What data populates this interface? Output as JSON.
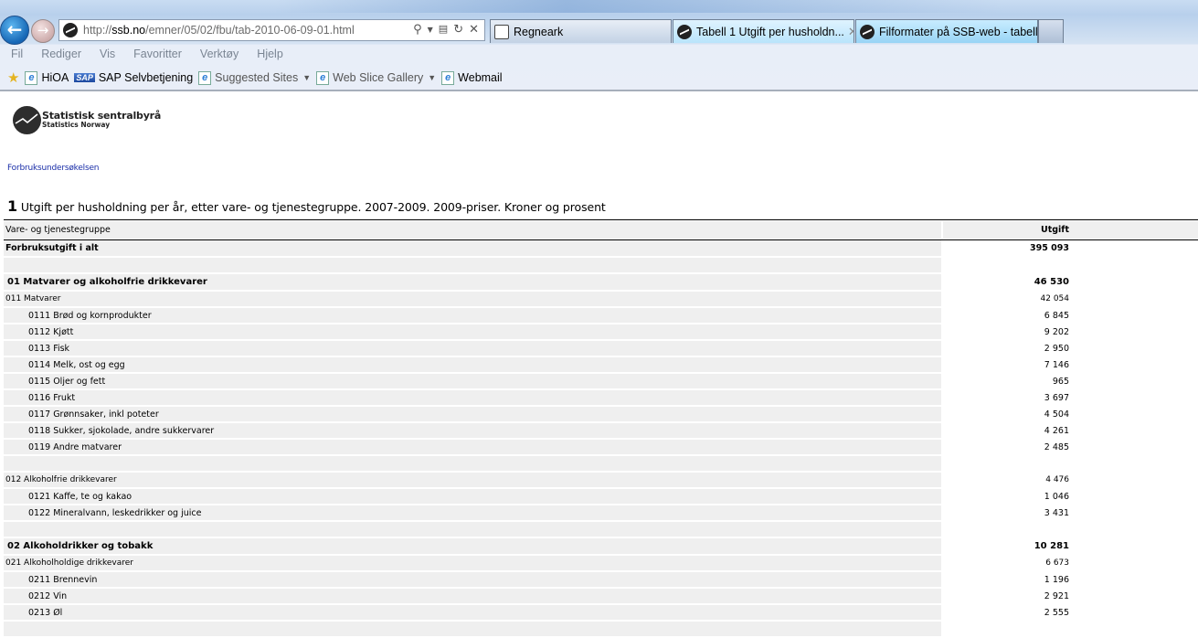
{
  "browser": {
    "address": {
      "url_prefix": "http://",
      "url_domain": "ssb.no",
      "url_path": "/emner/05/02/fbu/tab-2010-06-09-01.html",
      "icons": [
        "search-icon",
        "dropdown-icon",
        "compatibility-icon",
        "refresh-icon",
        "stop-icon"
      ]
    },
    "tabs": [
      {
        "label": "Regneark",
        "active": false
      },
      {
        "label": "Tabell 1 Utgift per husholdn...",
        "active": true
      },
      {
        "label": "Filformater på SSB-web - tabell...",
        "active": false
      }
    ],
    "menu": [
      "Fil",
      "Rediger",
      "Vis",
      "Favoritter",
      "Verktøy",
      "Hjelp"
    ],
    "favorites": [
      {
        "label": "HiOA",
        "icon": "ie-page-icon"
      },
      {
        "label": "SAP Selvbetjening",
        "icon": "sap-icon"
      },
      {
        "label": "Suggested Sites",
        "icon": "ie-page-icon",
        "dropdown": true
      },
      {
        "label": "Web Slice Gallery",
        "icon": "ie-page-icon",
        "dropdown": true
      },
      {
        "label": "Webmail",
        "icon": "ie-page-icon"
      }
    ]
  },
  "page": {
    "logo": {
      "line1": "Statistisk sentralbyrå",
      "line2": "Statistics Norway"
    },
    "breadcrumb": "Forbruksundersøkelsen",
    "title_number": "1",
    "title_text": " Utgift per husholdning per år, etter vare- og tjenestegruppe. 2007-2009. 2009-priser. Kroner og prosent",
    "table": {
      "headers": [
        "Vare- og tjenestegruppe",
        "Utgift"
      ],
      "rows": [
        {
          "label": "Forbruksutgift i alt",
          "value": "395 093",
          "level": 0
        },
        {
          "label": "",
          "value": "",
          "level": "blank"
        },
        {
          "label": "01 Matvarer og alkoholfrie drikkevarer",
          "value": "46 530",
          "level": 1
        },
        {
          "label": "011  Matvarer",
          "value": "42 054",
          "level": 2
        },
        {
          "label": "0111 Brød og kornprodukter",
          "value": "6 845",
          "level": 3
        },
        {
          "label": "0112 Kjøtt",
          "value": "9 202",
          "level": 3
        },
        {
          "label": "0113 Fisk",
          "value": "2 950",
          "level": 3
        },
        {
          "label": "0114 Melk, ost og egg",
          "value": "7 146",
          "level": 3
        },
        {
          "label": "0115 Oljer og fett",
          "value": "965",
          "level": 3
        },
        {
          "label": "0116 Frukt",
          "value": "3 697",
          "level": 3
        },
        {
          "label": "0117 Grønnsaker, inkl poteter",
          "value": "4 504",
          "level": 3
        },
        {
          "label": "0118 Sukker, sjokolade, andre sukkervarer",
          "value": "4 261",
          "level": 3
        },
        {
          "label": "0119 Andre matvarer",
          "value": "2 485",
          "level": 3
        },
        {
          "label": "",
          "value": "",
          "level": "blank"
        },
        {
          "label": "012 Alkoholfrie drikkevarer",
          "value": "4 476",
          "level": 2
        },
        {
          "label": "0121 Kaffe, te og kakao",
          "value": "1 046",
          "level": 3
        },
        {
          "label": "0122 Mineralvann, leskedrikker og juice",
          "value": "3 431",
          "level": 3
        },
        {
          "label": "",
          "value": "",
          "level": "blank"
        },
        {
          "label": "02 Alkoholdrikker og tobakk",
          "value": "10 281",
          "level": 1
        },
        {
          "label": "021 Alkoholholdige drikkevarer",
          "value": "6 673",
          "level": 2
        },
        {
          "label": "0211 Brennevin",
          "value": "1 196",
          "level": 3
        },
        {
          "label": "0212 Vin",
          "value": "2 921",
          "level": 3
        },
        {
          "label": "0213 Øl",
          "value": "2 555",
          "level": 3
        },
        {
          "label": "",
          "value": "",
          "level": "blank"
        }
      ]
    }
  }
}
